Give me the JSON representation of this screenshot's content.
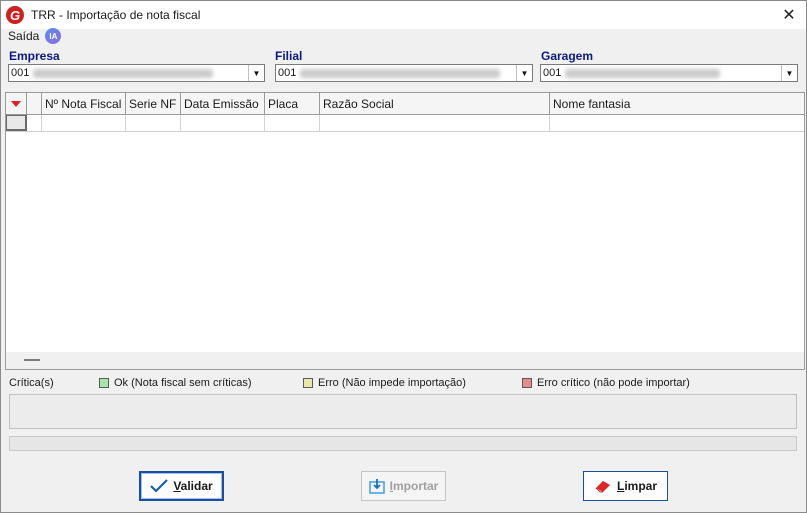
{
  "window": {
    "title": "TRR - Importação de nota fiscal",
    "close": "✕"
  },
  "menu": {
    "saida": "Saída",
    "ia_badge": "IA"
  },
  "fields": {
    "empresa": {
      "label": "Empresa",
      "code": "001"
    },
    "filial": {
      "label": "Filial",
      "code": "001"
    },
    "garagem": {
      "label": "Garagem",
      "code": "001"
    }
  },
  "grid": {
    "columns": [
      "Nº Nota Fiscal",
      "Serie NF",
      "Data Emissão",
      "Placa",
      "Razão Social",
      "Nome fantasia"
    ]
  },
  "legend": {
    "title": "Crítica(s)",
    "items": [
      {
        "label": "Ok (Nota fiscal sem críticas)",
        "color": "#a8e6a8"
      },
      {
        "label": "Erro (Não impede importação)",
        "color": "#ece7a6"
      },
      {
        "label": "Erro crítico (não pode importar)",
        "color": "#e88a8a"
      }
    ]
  },
  "buttons": {
    "validar": {
      "first": "V",
      "rest": "alidar"
    },
    "importar": {
      "first": "I",
      "rest": "mportar"
    },
    "limpar": {
      "first": "L",
      "rest": "impar"
    }
  },
  "icons": {
    "validar": "check-icon",
    "importar": "import-icon",
    "limpar": "eraser-icon"
  }
}
